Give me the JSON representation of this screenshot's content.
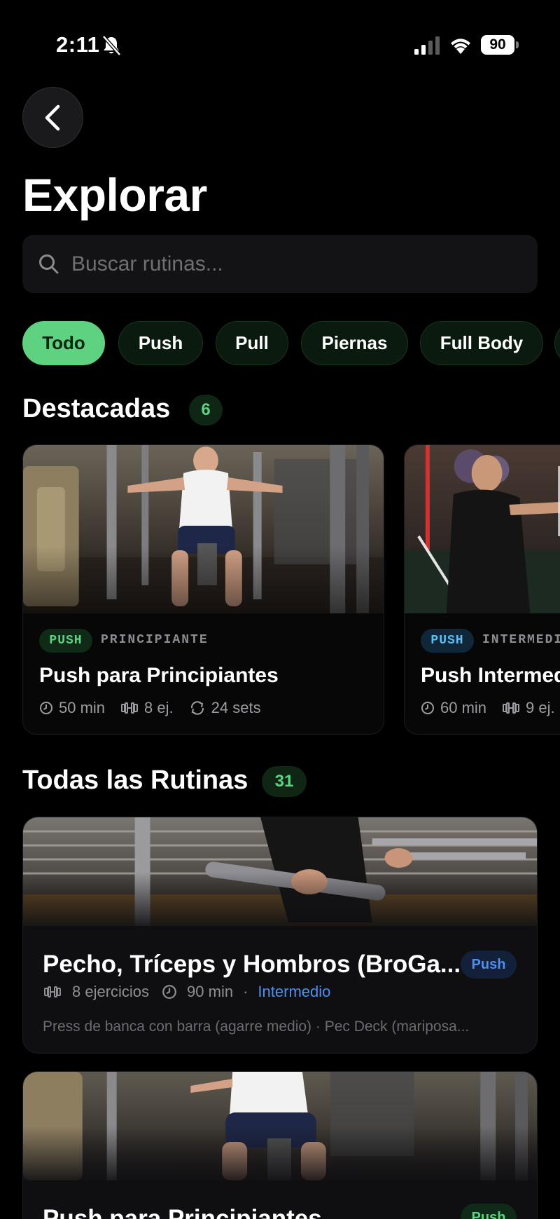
{
  "status_bar": {
    "time": "2:11",
    "battery": "90"
  },
  "header": {
    "title": "Explorar"
  },
  "search": {
    "placeholder": "Buscar rutinas..."
  },
  "filters": {
    "chips": [
      "Todo",
      "Push",
      "Pull",
      "Piernas",
      "Full Body"
    ],
    "active": "Todo"
  },
  "featured": {
    "title": "Destacadas",
    "count": "6",
    "cards": [
      {
        "tag": "PUSH",
        "level": "PRINCIPIANTE",
        "title": "Push para Principiantes",
        "duration": "50 min",
        "exercises": "8 ej.",
        "sets": "24 sets"
      },
      {
        "tag": "PUSH",
        "level": "INTERMEDIO",
        "title": "Push Intermedio",
        "duration": "60 min",
        "exercises": "9 ej."
      }
    ]
  },
  "all_routines": {
    "title": "Todas las Rutinas",
    "count": "31",
    "cards": [
      {
        "title": "Pecho, Tríceps y Hombros (BroGa...",
        "type": "Push",
        "exercises": "8 ejercicios",
        "duration": "90 min",
        "separator": "·",
        "level": "Intermedio",
        "exercise_list": "Press de banca con barra (agarre medio) · Pec Deck (mariposa..."
      },
      {
        "title": "Push para Principiantes",
        "type": "Push"
      }
    ]
  },
  "colors": {
    "accent_green": "#5ed281",
    "accent_blue": "#5fbdf0",
    "level_blue": "#4c8ff0",
    "background": "#000000"
  }
}
